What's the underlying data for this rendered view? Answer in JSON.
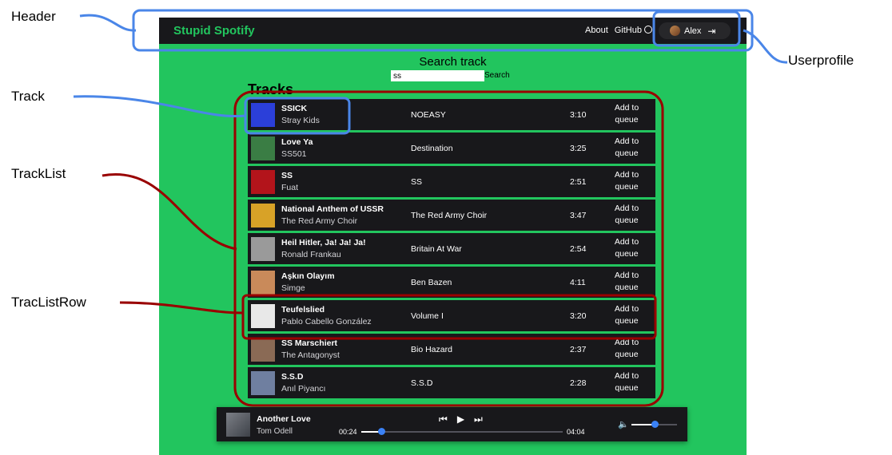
{
  "header": {
    "brand": "Stupid Spotify",
    "about": "About",
    "github": "GitHub",
    "user_name": "Alex",
    "logout_icon": "logout-icon"
  },
  "search": {
    "title": "Search track",
    "value": "ss",
    "button": "Search"
  },
  "tracks_heading": "Tracks",
  "queue_label": "Add to queue",
  "tracks": [
    {
      "title": "SSICK",
      "artist": "Stray Kids",
      "album": "NOEASY",
      "duration": "3:10",
      "cover_color": "#2b3fd9"
    },
    {
      "title": "Love Ya",
      "artist": "SS501",
      "album": "Destination",
      "duration": "3:25",
      "cover_color": "#3a7d44"
    },
    {
      "title": "SS",
      "artist": "Fuat",
      "album": "SS",
      "duration": "2:51",
      "cover_color": "#b3141b"
    },
    {
      "title": "National Anthem of USSR",
      "artist": "The Red Army Choir",
      "album": "The Red Army Choir",
      "duration": "3:47",
      "cover_color": "#d8a227"
    },
    {
      "title": "Heil Hitler, Ja! Ja! Ja!",
      "artist": "Ronald Frankau",
      "album": "Britain At War",
      "duration": "2:54",
      "cover_color": "#9a9a9a"
    },
    {
      "title": "Aşkın Olayım",
      "artist": "Simge",
      "album": "Ben Bazen",
      "duration": "4:11",
      "cover_color": "#c98a5a"
    },
    {
      "title": "Teufelslied",
      "artist": "Pablo Cabello González",
      "album": "Volume I",
      "duration": "3:20",
      "cover_color": "#e8e8e8"
    },
    {
      "title": "SS Marschiert",
      "artist": "The Antagonyst",
      "album": "Bio Hazard",
      "duration": "2:37",
      "cover_color": "#8a6a55"
    },
    {
      "title": "S.S.D",
      "artist": "Anıl Piyancı",
      "album": "S.S.D",
      "duration": "2:28",
      "cover_color": "#6f7fa0"
    }
  ],
  "player": {
    "title": "Another Love",
    "artist": "Tom Odell",
    "current_time": "00:24",
    "duration": "04:04",
    "progress": 0.1,
    "volume": 0.5
  },
  "annotations": {
    "header": "Header",
    "track": "Track",
    "tracklist": "TrackList",
    "tracklistrow": "TracListRow",
    "userprofile": "Userprofile"
  },
  "colors": {
    "page_bg": "#22c55e",
    "header_bg": "#18181b",
    "brand": "#22c55e",
    "blue_annotation": "#4a86e8",
    "red_annotation": "#990000",
    "slider_knob": "#3b82f6"
  }
}
